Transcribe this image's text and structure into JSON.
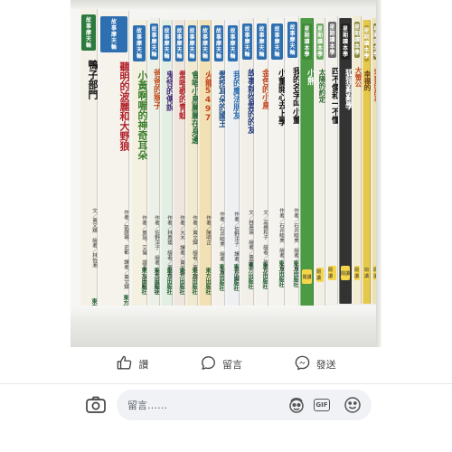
{
  "post_photo": {
    "books": [
      {
        "series": [
          "故",
          "事",
          "摩",
          "天",
          "輪"
        ],
        "title": "鴨子部門",
        "author": "文／黃文輝　繪者／林怡湘",
        "publisher": "東方出版社",
        "bg": "#f4f1e8",
        "series_color": "#2d7a3e",
        "title_color": "#111"
      },
      {
        "series": [
          "故",
          "事",
          "摩",
          "天",
          "輪"
        ],
        "title": "聽明的波麗和大野狼",
        "author": "作者／凱薩琳．史都　譯者／黃文輝",
        "publisher": "東方出版社",
        "bg": "#f5f3ec",
        "series_color": "#2d6fb0",
        "title_color": "#b3202a"
      },
      {
        "series": [
          "故",
          "事",
          "摩",
          "天",
          "輪"
        ],
        "title": "小黃啊喔的神奇耳朵",
        "author": "作者／莫瑞．艾倫　譯者／游宗鈺",
        "publisher": "東方出版社",
        "bg": "#f4f1e3",
        "series_color": "#2d6fb0",
        "title_color": "#3b7e2b"
      },
      {
        "series": [
          "故",
          "事",
          "摩",
          "天",
          "輪"
        ],
        "title": "爸爸的猴子",
        "author": "作者／佐野洋子　繪者／宮山美知子",
        "publisher": "東方出版社",
        "bg": "#ecf0e6",
        "series_color": "#2d6fb0",
        "title_color": "#c24e1e"
      },
      {
        "series": [
          "故",
          "事",
          "摩",
          "天",
          "輪"
        ],
        "title": "鬼怪的傳說",
        "author": "作者／林惠瑛　繪者／黃雪萍",
        "publisher": "東方出版社",
        "bg": "#e4efe4",
        "series_color": "#2d6fb0",
        "title_color": "#4a2f7a"
      },
      {
        "series": [
          "故",
          "事",
          "摩",
          "天",
          "輪"
        ],
        "title": "愛唱歌的青蛙",
        "author": "作者／大木　譯者／黃文輝",
        "publisher": "東方出版社",
        "bg": "#efe7de",
        "series_color": "#2d6fb0",
        "title_color": "#b3202a"
      },
      {
        "series": [
          "故",
          "事",
          "摩",
          "天",
          "輪"
        ],
        "title": "會唱小鳥麗麗在身邊",
        "author": "作者／黃文輝　繪者／黃文輝",
        "publisher": "東方出版社",
        "bg": "#f2ead0",
        "series_color": "#2d6fb0",
        "title_color": "#2a6a3c"
      },
      {
        "series": [
          "故",
          "事",
          "摩",
          "天",
          "輪"
        ],
        "title": "火龍5497",
        "author": "作者／陳明正",
        "publisher": "東方出版社",
        "bg": "#f3e1b6",
        "series_color": "#2d6fb0",
        "title_color": "#c2471e"
      },
      {
        "series": [
          "故",
          "事",
          "摩",
          "天",
          "輪"
        ],
        "title": "愛挖耳朵的國王",
        "author": "作者／石井睦美　繪者／朱里",
        "publisher": "東方出版社",
        "bg": "#f3f1ea",
        "series_color": "#2d6fb0",
        "title_color": "#1f4d8b"
      },
      {
        "series": [
          "故",
          "事",
          "摩",
          "天",
          "輪"
        ],
        "title": "我的魔法朋友",
        "author": "作者／佐野洋子　譯者／黃文輝",
        "publisher": "東方出版社",
        "bg": "#eef0f2",
        "series_color": "#2d6fb0",
        "title_color": "#2d6fb0"
      },
      {
        "series": [
          "故",
          "事",
          "摩",
          "天",
          "輪"
        ],
        "title": "故事就從愛的的友",
        "author": "文／林惠瑛　繪者／黃雪萍",
        "publisher": "東方出版社",
        "bg": "#f2efe8",
        "series_color": "#2d6fb0",
        "title_color": "#1f3b7a"
      },
      {
        "series": [
          "故",
          "事",
          "摩",
          "天",
          "輪"
        ],
        "title": "金色的小鳥",
        "author": "文／高橋和子　繪者／佐藤正",
        "publisher": "東方出版社",
        "bg": "#f4f2ec",
        "series_color": "#2d6fb0",
        "title_color": "#c2471e"
      },
      {
        "series": [
          "故",
          "事",
          "摩",
          "天",
          "輪"
        ],
        "title": "小董開心去上學",
        "author": "作者／石井睦美　繪者／朱里",
        "publisher": "東方出版社",
        "bg": "#f4f3ee",
        "series_color": "#2d6fb0",
        "title_color": "#111"
      },
      {
        "series": [
          "故",
          "事",
          "摩",
          "天",
          "輪"
        ],
        "title": "我的名字叫小董",
        "author": "作者／石井睦美　繪者／朱里",
        "publisher": "東方出版社",
        "bg": "#f4f3ee",
        "series_color": "#2d6fb0",
        "title_color": "#111"
      },
      {
        "series": [
          "星",
          "期",
          "讀",
          "本",
          "學",
          "堂"
        ],
        "title": "小熊",
        "author": "",
        "publisher": "",
        "bg": "#4d9a45",
        "series_color": "#3e8a38",
        "title_color": "#ffffff"
      },
      {
        "series": [
          "星",
          "期",
          "讀",
          "本",
          "學",
          "堂"
        ],
        "title": "太陽的約定",
        "author": "",
        "publisher": "",
        "bg": "#f2efe6",
        "series_color": "#6aa85e",
        "title_color": "#2a6a2a"
      },
      {
        "series": [
          "星",
          "期",
          "讀",
          "本",
          "學",
          "堂"
        ],
        "title": "四不像和一不懂",
        "author": "",
        "publisher": "",
        "bg": "#f3f1ec",
        "series_color": "#6a6a6a",
        "title_color": "#111"
      },
      {
        "series": [
          "星",
          "期",
          "讀",
          "本",
          "學",
          "堂"
        ],
        "title": "狐狸亂亂學",
        "author": "",
        "publisher": "",
        "bg": "#333333",
        "series_color": "#222",
        "title_color": "#ffffff"
      },
      {
        "series": [
          "星",
          "期",
          "讀",
          "本",
          "學",
          "堂"
        ],
        "title": "大螢公",
        "author": "",
        "publisher": "",
        "bg": "#f3ecd0",
        "series_color": "#8a8a3a",
        "title_color": "#c2471e"
      },
      {
        "series": [
          "星",
          "期",
          "讀",
          "本",
          "學",
          "堂"
        ],
        "title": "幸福的",
        "author": "",
        "publisher": "",
        "bg": "#e6c84a",
        "series_color": "#b69a2e",
        "title_color": "#6a3a16"
      },
      {
        "series": [
          "星",
          "期",
          "讀",
          "本",
          "學",
          "堂"
        ],
        "title": "笨狼的故事",
        "author": "",
        "publisher": "",
        "bg": "#eae1b4",
        "series_color": "#8a7a3a",
        "title_color": "#c2471e"
      }
    ],
    "yellow_tag_text": "閱讀"
  },
  "actions": {
    "like_label": "讚",
    "comment_label": "留言",
    "share_label": "發送"
  },
  "composer": {
    "placeholder": "留言……",
    "gif_label": "GIF"
  },
  "colors": {
    "icon": "#444444",
    "field_bg": "#f0f2f5"
  }
}
